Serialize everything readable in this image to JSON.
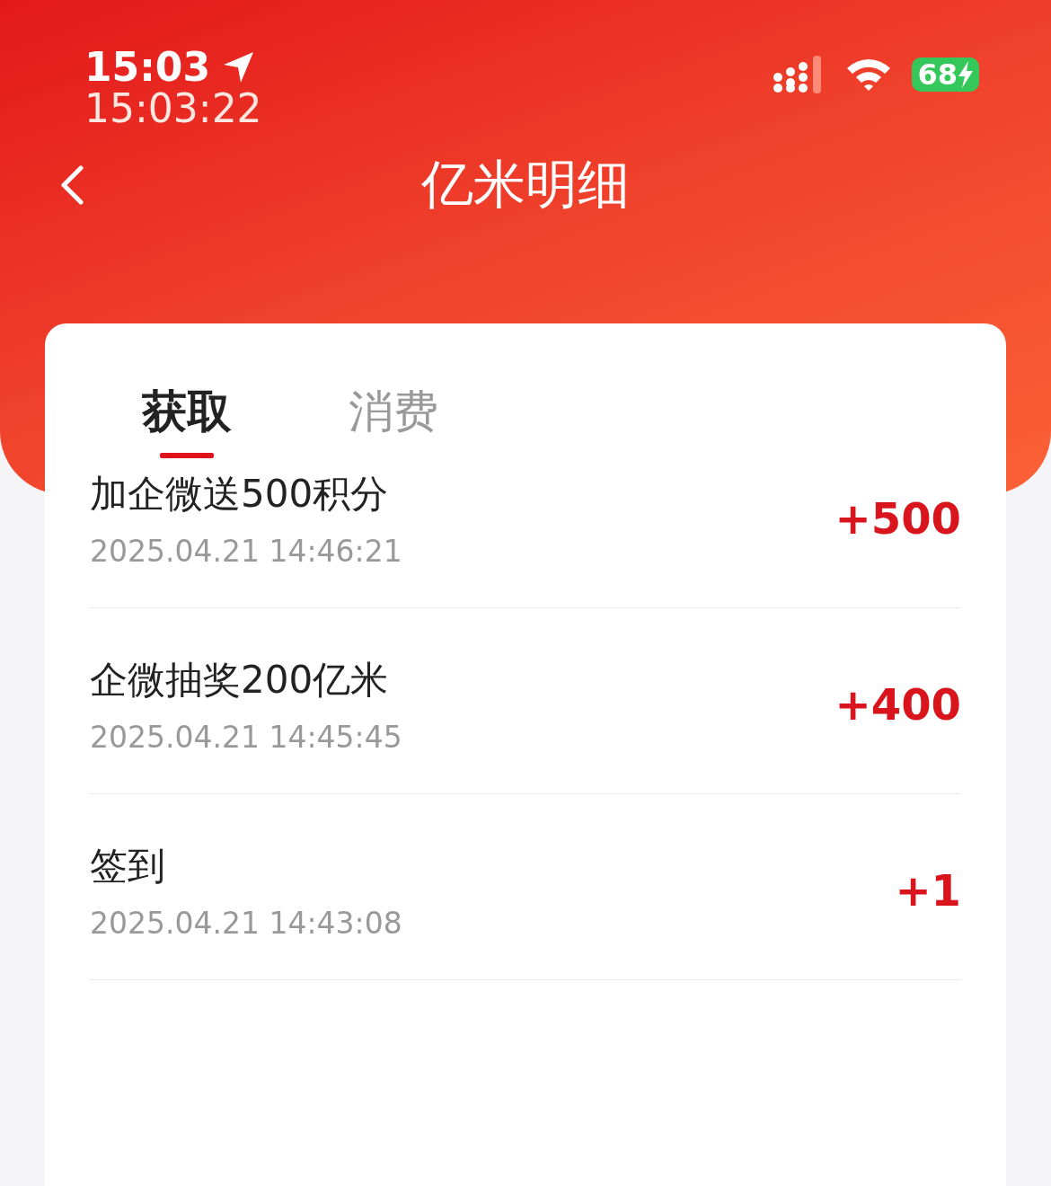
{
  "status_bar": {
    "time": "15:03",
    "clock": "15:03:22",
    "battery": "68"
  },
  "header": {
    "title": "亿米明细"
  },
  "tabs": [
    {
      "label": "获取",
      "selected": true
    },
    {
      "label": "消费",
      "selected": false
    }
  ],
  "records": [
    {
      "title": "加企微送500积分",
      "time": "2025.04.21 14:46:21",
      "amount": "+500"
    },
    {
      "title": "企微抽奖200亿米",
      "time": "2025.04.21 14:45:45",
      "amount": "+400"
    },
    {
      "title": "签到",
      "time": "2025.04.21 14:43:08",
      "amount": "+1"
    }
  ]
}
